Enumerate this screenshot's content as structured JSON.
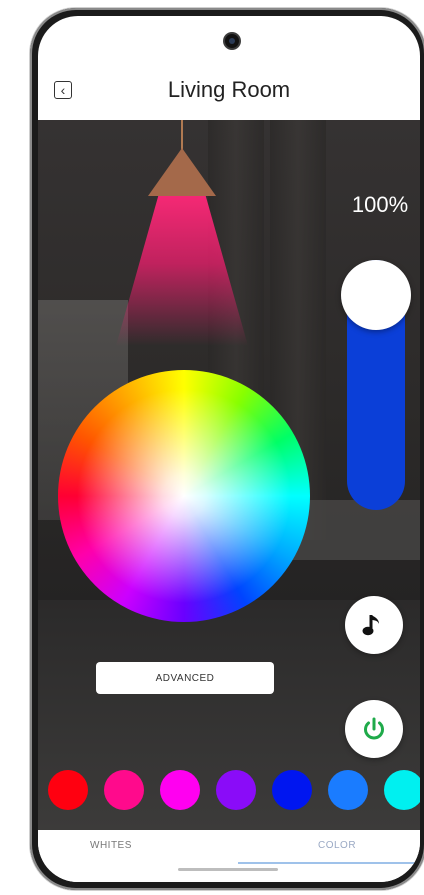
{
  "header": {
    "title": "Living Room",
    "back_icon": "chevron-left-icon"
  },
  "brightness": {
    "label": "100%",
    "level": 1.0
  },
  "controls": {
    "advanced_label": "ADVANCED",
    "music_icon": "music-note-icon",
    "power_icon": "power-icon"
  },
  "colors": {
    "slider_fill": "#0b3fd8",
    "power_accent": "#1faa4a",
    "lamp_glow": "#ff2878"
  },
  "swatches": [
    {
      "name": "red",
      "color": "#ff0010"
    },
    {
      "name": "deep-pink",
      "color": "#ff0a8c"
    },
    {
      "name": "magenta",
      "color": "#ff00f0"
    },
    {
      "name": "violet",
      "color": "#8a0cf8"
    },
    {
      "name": "blue",
      "color": "#0016f0"
    },
    {
      "name": "azure",
      "color": "#1a7cff"
    },
    {
      "name": "cyan",
      "color": "#00f0f0"
    }
  ],
  "tabs": [
    {
      "label": "WHITES",
      "active": false
    },
    {
      "label": "COLOR",
      "active": true
    }
  ]
}
